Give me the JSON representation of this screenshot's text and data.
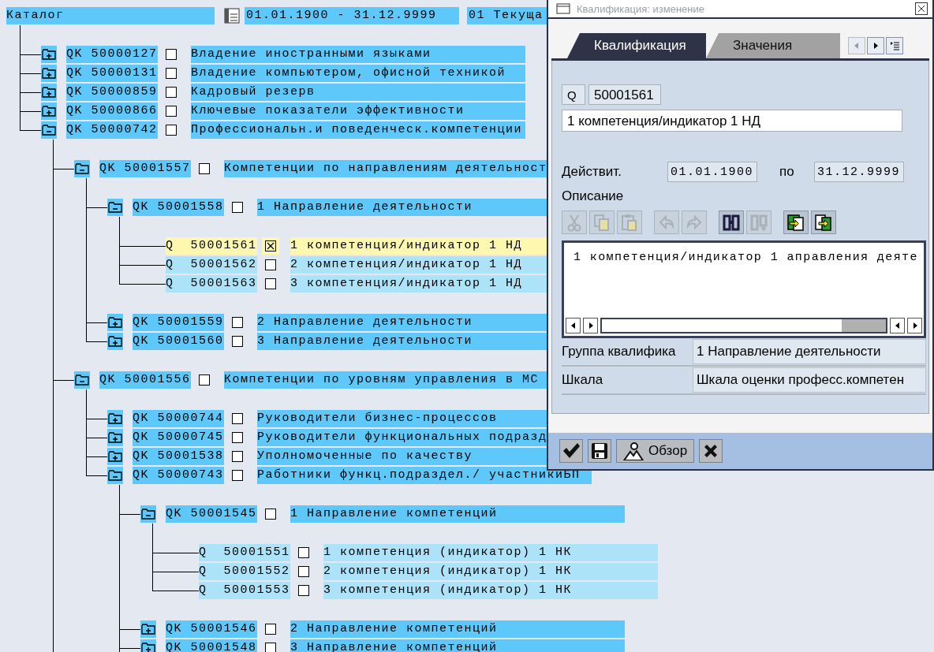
{
  "catalog": {
    "title": "Каталог",
    "period": "01.01.1900 - 31.12.9999",
    "variant": "01 Текуща"
  },
  "tree": [
    {
      "kind": "folder",
      "expanded": false,
      "code": "QK 50000127",
      "checked": false,
      "selected": false,
      "text": "Владение иностранными языками"
    },
    {
      "kind": "folder",
      "expanded": false,
      "code": "QK 50000131",
      "checked": false,
      "selected": false,
      "text": "Владение компьютером, офисной техникой"
    },
    {
      "kind": "folder",
      "expanded": false,
      "code": "QK 50000859",
      "checked": false,
      "selected": false,
      "text": "Кадровый резерв"
    },
    {
      "kind": "folder",
      "expanded": false,
      "code": "QK 50000866",
      "checked": false,
      "selected": false,
      "text": "Ключевые показатели эффективности"
    },
    {
      "kind": "folder",
      "expanded": true,
      "code": "QK 50000742",
      "checked": false,
      "selected": false,
      "text": "Профессиональн.и поведенческ.компетенции",
      "more_below": true,
      "children": [
        {
          "kind": "folder",
          "expanded": true,
          "code": "QK 50001557",
          "checked": false,
          "selected": false,
          "text": "Компетенции по направлениям деятельност",
          "children": [
            {
              "kind": "folder",
              "expanded": true,
              "code": "QK 50001558",
              "checked": false,
              "selected": false,
              "text": "1 Направление деятельности",
              "children": [
                {
                  "kind": "leaf",
                  "code": "Q  50001561",
                  "checked": true,
                  "selected": true,
                  "text": "1 компетенция/индикатор 1 НД"
                },
                {
                  "kind": "leaf",
                  "code": "Q  50001562",
                  "checked": false,
                  "selected": false,
                  "text": "2 компетенция/индикатор 1 НД"
                },
                {
                  "kind": "leaf",
                  "code": "Q  50001563",
                  "checked": false,
                  "selected": false,
                  "text": "3 компетенция/индикатор 1 НД"
                }
              ]
            },
            {
              "kind": "folder",
              "expanded": false,
              "code": "QK 50001559",
              "checked": false,
              "selected": false,
              "text": "2 Направление деятельности"
            },
            {
              "kind": "folder",
              "expanded": false,
              "code": "QK 50001560",
              "checked": false,
              "selected": false,
              "text": "3 Направление деятельности"
            }
          ]
        },
        {
          "kind": "folder",
          "expanded": true,
          "code": "QK 50001556",
          "checked": false,
          "selected": false,
          "text": "Компетенции по уровням управления в МС",
          "children": [
            {
              "kind": "folder",
              "expanded": false,
              "code": "QK 50000744",
              "checked": false,
              "selected": false,
              "text": "Руководители бизнес-процессов"
            },
            {
              "kind": "folder",
              "expanded": false,
              "code": "QK 50000745",
              "checked": false,
              "selected": false,
              "text": "Руководители функциональных подразд"
            },
            {
              "kind": "folder",
              "expanded": false,
              "code": "QK 50001538",
              "checked": false,
              "selected": false,
              "text": "Уполномоченные по качеству"
            },
            {
              "kind": "folder",
              "expanded": true,
              "code": "QK 50000743",
              "checked": false,
              "selected": false,
              "text": "Работники функц.подраздел./ участникиБП",
              "more_below": true,
              "children": [
                {
                  "kind": "folder",
                  "expanded": true,
                  "code": "QK 50001545",
                  "checked": false,
                  "selected": false,
                  "text": "1 Направление компетенций",
                  "children": [
                    {
                      "kind": "leaf",
                      "code": "Q  50001551",
                      "checked": false,
                      "selected": false,
                      "text": "1 компетенция (индикатор) 1 НК"
                    },
                    {
                      "kind": "leaf",
                      "code": "Q  50001552",
                      "checked": false,
                      "selected": false,
                      "text": "2 компетенция (индикатор) 1 НК"
                    },
                    {
                      "kind": "leaf",
                      "code": "Q  50001553",
                      "checked": false,
                      "selected": false,
                      "text": "3 компетенция (индикатор) 1 НК"
                    }
                  ]
                },
                {
                  "kind": "folder",
                  "expanded": false,
                  "code": "QK 50001546",
                  "checked": false,
                  "selected": false,
                  "text": "2 Направление компетенций"
                },
                {
                  "kind": "folder",
                  "expanded": false,
                  "code": "QK 50001548",
                  "checked": false,
                  "selected": false,
                  "text": "3 Направление компетенций"
                }
              ]
            }
          ]
        }
      ]
    }
  ],
  "dialog": {
    "title": "Квалификация: изменение",
    "tabs": [
      {
        "label": "Квалификация",
        "selected": true
      },
      {
        "label": "Значения",
        "selected": false
      }
    ],
    "object_type": "Q",
    "object_id": "50001561",
    "name": "1 компетенция/индикатор 1 НД",
    "valid_label": "Действит.",
    "valid_from": "01.01.1900",
    "to_label": "по",
    "valid_to": "31.12.9999",
    "description_label": "Описание",
    "editor_tools": [
      {
        "kind": "cut",
        "disabled": true
      },
      {
        "kind": "copy",
        "disabled": true
      },
      {
        "kind": "paste",
        "disabled": true
      },
      {
        "kind": "undo",
        "disabled": true
      },
      {
        "kind": "redo",
        "disabled": true
      },
      {
        "kind": "find",
        "disabled": false
      },
      {
        "kind": "find-next",
        "disabled": true
      },
      {
        "kind": "import",
        "disabled": false
      },
      {
        "kind": "export",
        "disabled": false
      }
    ],
    "description_text": "1 компетенция/индикатор 1 аправления деяте",
    "fields": [
      {
        "label": "Группа квалифика",
        "value": "1 Направление деятельности"
      },
      {
        "label": "Шкала",
        "value": "Шкала оценки професс.компетен"
      }
    ],
    "buttons": [
      {
        "kind": "confirm"
      },
      {
        "kind": "save"
      },
      {
        "kind": "overview",
        "label": "Обзор"
      },
      {
        "kind": "cancel"
      }
    ]
  }
}
